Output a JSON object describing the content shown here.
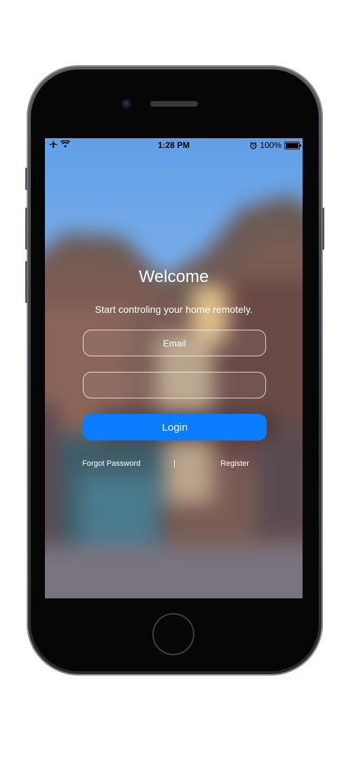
{
  "status_bar": {
    "time": "1:28 PM",
    "battery": "100%",
    "icons": [
      "airplane-icon",
      "wifi-icon",
      "alarm-icon",
      "battery-icon"
    ]
  },
  "login": {
    "title": "Welcome",
    "subtitle": "Start controling your home remotely.",
    "email_placeholder": "Email",
    "password_placeholder": "",
    "login_label": "Login",
    "forgot_label": "Forgot Password",
    "divider": "|",
    "register_label": "Register"
  },
  "colors": {
    "accent": "#0a7cff",
    "sky": "#7db2ea",
    "text": "#ffffff"
  }
}
